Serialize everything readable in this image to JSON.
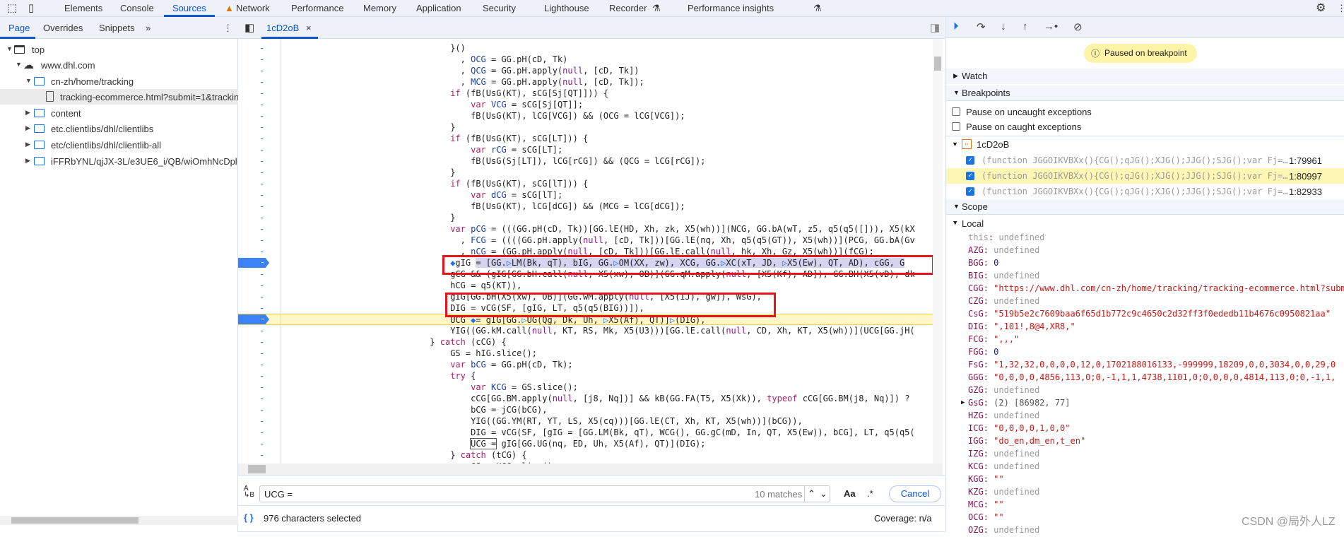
{
  "top_tabs": {
    "icons": [
      "inspect-element-icon",
      "device-toolbar-icon"
    ],
    "items": [
      "Elements",
      "Console",
      "Sources",
      "Network",
      "Performance",
      "Memory",
      "Application",
      "Security",
      "Lighthouse",
      "Recorder",
      "Performance insights"
    ],
    "active": "Sources",
    "network_warning": "warning-icon",
    "experimental": "flask-icon"
  },
  "left": {
    "tabs": [
      "Page",
      "Overrides",
      "Snippets"
    ],
    "more": "»",
    "active": "Page",
    "tree": [
      {
        "label": "top",
        "icon": "frame",
        "expanded": true
      },
      {
        "label": "www.dhl.com",
        "icon": "cloud",
        "expanded": true
      },
      {
        "label": "cn-zh/home/tracking",
        "icon": "folder",
        "expanded": true
      },
      {
        "label": "tracking-ecommerce.html?submit=1&tracking",
        "icon": "file",
        "selected": true
      },
      {
        "label": "content",
        "icon": "folder"
      },
      {
        "label": "etc.clientlibs/dhl/clientlibs",
        "icon": "folder"
      },
      {
        "label": "etc/clientlibs/dhl/clientlib-all",
        "icon": "folder"
      },
      {
        "label": "iFFRbYNL/qjJX-3L/e3UE6_i/QB/wiOmhNcDpl",
        "icon": "folder"
      }
    ]
  },
  "editor": {
    "tab": "1cD2oB",
    "close": "×"
  },
  "code": {
    "gutter": "-",
    "lines": [
      [
        [
          "                                }()",
          "p"
        ]
      ],
      [
        [
          "                                  , ",
          "p"
        ],
        [
          "OCG",
          "d"
        ],
        [
          " = GG.pH(cD, Tk)",
          "p"
        ]
      ],
      [
        [
          "                                  , ",
          "p"
        ],
        [
          "QCG",
          "d"
        ],
        [
          " = GG.pH.apply(",
          "p"
        ],
        [
          "null",
          "n"
        ],
        [
          ", [cD, Tk])",
          "p"
        ]
      ],
      [
        [
          "                                  , ",
          "p"
        ],
        [
          "MCG",
          "d"
        ],
        [
          " = GG.pH.apply(",
          "p"
        ],
        [
          "null",
          "n"
        ],
        [
          ", [cD, Tk]);",
          "p"
        ]
      ],
      [
        [
          "                                ",
          "p"
        ],
        [
          "if",
          "k"
        ],
        [
          " (fB(UsG(KT), sCG[Sj[QT]])) {",
          "p"
        ]
      ],
      [
        [
          "                                    ",
          "p"
        ],
        [
          "var",
          "k"
        ],
        [
          " ",
          "p"
        ],
        [
          "VCG",
          "d"
        ],
        [
          " = sCG[Sj[QT]];",
          "p"
        ]
      ],
      [
        [
          "                                    fB(UsG(KT), lCG[VCG]) && (OCG = lCG[VCG]);",
          "p"
        ]
      ],
      [
        [
          "                                }",
          "p"
        ]
      ],
      [
        [
          "                                ",
          "p"
        ],
        [
          "if",
          "k"
        ],
        [
          " (fB(UsG(KT), sCG[LT])) {",
          "p"
        ]
      ],
      [
        [
          "                                    ",
          "p"
        ],
        [
          "var",
          "k"
        ],
        [
          " ",
          "p"
        ],
        [
          "rCG",
          "d"
        ],
        [
          " = sCG[LT];",
          "p"
        ]
      ],
      [
        [
          "                                    fB(UsG(Sj[LT]), lCG[rCG]) && (QCG = lCG[rCG]);",
          "p"
        ]
      ],
      [
        [
          "                                }",
          "p"
        ]
      ],
      [
        [
          "                                ",
          "p"
        ],
        [
          "if",
          "k"
        ],
        [
          " (fB(UsG(KT), sCG[lT])) {",
          "p"
        ]
      ],
      [
        [
          "                                    ",
          "p"
        ],
        [
          "var",
          "k"
        ],
        [
          " ",
          "p"
        ],
        [
          "dCG",
          "d"
        ],
        [
          " = sCG[lT];",
          "p"
        ]
      ],
      [
        [
          "                                    fB(UsG(KT), lCG[dCG]) && (MCG = lCG[dCG]);",
          "p"
        ]
      ],
      [
        [
          "                                }",
          "p"
        ]
      ],
      [
        [
          "                                ",
          "p"
        ],
        [
          "var",
          "k"
        ],
        [
          " ",
          "p"
        ],
        [
          "pCG",
          "d"
        ],
        [
          " = (((GG.pH(cD, Tk))[GG.lE(HD, Xh, zk, X5(wh))](NCG, GG.bA(wT, z5, q5(q5([])), X5(kX",
          "p"
        ]
      ],
      [
        [
          "                                  , ",
          "p"
        ],
        [
          "FCG",
          "d"
        ],
        [
          " = ((((GG.pH.apply(",
          "p"
        ],
        [
          "null",
          "n"
        ],
        [
          ", [cD, Tk]))[GG.lE(nq, Xh, q5(q5(GT)), X5(wh))](PCG, GG.bA(Gv",
          "p"
        ]
      ],
      [
        [
          "                                  , ",
          "p"
        ],
        [
          "nCG",
          "d"
        ],
        [
          " = (GG.pH.apply(",
          "p"
        ],
        [
          "null",
          "n"
        ],
        [
          ", [cD, Tk]))[GG.lE.call(",
          "p"
        ],
        [
          "null",
          "n"
        ],
        [
          ", hk, Xh, Gz, X5(wh))](fCG);",
          "p"
        ]
      ],
      [
        [
          "                                ",
          "p"
        ],
        [
          "◆",
          "m"
        ],
        [
          "gIG ",
          "p"
        ],
        [
          "= [GG.",
          "sel"
        ],
        [
          "▷",
          "m sel"
        ],
        [
          "LM(Bk, qT), bIG, GG.",
          "sel"
        ],
        [
          "▷",
          "m sel"
        ],
        [
          "OM(XX, zw), XCG, GG.",
          "sel"
        ],
        [
          "▷",
          "m sel"
        ],
        [
          "XC(xT, JD, ",
          "sel"
        ],
        [
          "▷",
          "m sel"
        ],
        [
          "X5(Ew), QT, AD), cGG, G",
          "sel"
        ]
      ],
      [
        [
          "                                gCG && (gIG[GG.bH.call(",
          "p"
        ],
        [
          "null",
          "n"
        ],
        [
          ", X5(xw), OB)](GG.qM.apply(",
          "p"
        ],
        [
          "null",
          "n"
        ],
        [
          ", [X5(Kf), AD]), GG.BH(X5(vD), dk",
          "p"
        ]
      ],
      [
        [
          "                                hCG = q5(KT)),",
          "p"
        ]
      ],
      [
        [
          "                                gIG[GG.bH(X5(xw), OB)](GG.wM.apply(",
          "p"
        ],
        [
          "null",
          "n"
        ],
        [
          ", [X5(IJ), gw]), WsG),",
          "p"
        ]
      ],
      [
        [
          "                                DIG = vCG(SF, [gIG, LT, q5(q5(BIG))]),",
          "p"
        ]
      ],
      [
        [
          "                                UCG ",
          "p"
        ],
        [
          "◆",
          "m"
        ],
        [
          "= gIG[GG.",
          "p"
        ],
        [
          "▷",
          "m"
        ],
        [
          "UG(Qg, Dk, Uh, ",
          "p"
        ],
        [
          "▷",
          "m"
        ],
        [
          "X5(Af), QT)]",
          "p"
        ],
        [
          "▷",
          "m"
        ],
        [
          "(DIG),",
          "p"
        ]
      ],
      [
        [
          "                                YIG((GG.kM.call(",
          "p"
        ],
        [
          "null",
          "n"
        ],
        [
          ", KT, RS, Mk, X5(U3)))[GG.lE.call(",
          "p"
        ],
        [
          "null",
          "n"
        ],
        [
          ", CD, Xh, KT, X5(wh))](UCG[GG.jH(",
          "p"
        ]
      ],
      [
        [
          "                            } ",
          "p"
        ],
        [
          "catch",
          "k"
        ],
        [
          " (cCG) {",
          "p"
        ]
      ],
      [
        [
          "                                GS = hIG.slice();",
          "p"
        ]
      ],
      [
        [
          "                                ",
          "p"
        ],
        [
          "var",
          "k"
        ],
        [
          " ",
          "p"
        ],
        [
          "bCG",
          "d"
        ],
        [
          " = GG.pH(cD, Tk);",
          "p"
        ]
      ],
      [
        [
          "                                ",
          "p"
        ],
        [
          "try",
          "k"
        ],
        [
          " {",
          "p"
        ]
      ],
      [
        [
          "                                    ",
          "p"
        ],
        [
          "var",
          "k"
        ],
        [
          " ",
          "p"
        ],
        [
          "KCG",
          "d"
        ],
        [
          " = GS.slice();",
          "p"
        ]
      ],
      [
        [
          "                                    cCG[GG.BM.apply(",
          "p"
        ],
        [
          "null",
          "n"
        ],
        [
          ", [j8, Nq])] && kB(GG.FA(T5, X5(Xk)), ",
          "p"
        ],
        [
          "typeof",
          "k"
        ],
        [
          " cCG[GG.BM(j8, Nq)]) ?",
          "p"
        ]
      ],
      [
        [
          "                                    bCG = jCG(bCG),",
          "p"
        ]
      ],
      [
        [
          "                                    YIG((GG.YM(RT, YT, LS, X5(cq)))[GG.lE(CT, Xh, KT, X5(wh))](bCG)),",
          "p"
        ]
      ],
      [
        [
          "                                    DIG = vCG(SF, [gIG = [GG.LM(Bk, qT), WCG(), GG.gC(mD, In, QT, X5(Ew)), bCG], LT, q5(q5(",
          "p"
        ]
      ],
      [
        [
          "                                    ",
          "p"
        ],
        [
          "UCG =",
          "p box"
        ],
        [
          " gIG[GG.UG(nq, ED, Uh, X5(Af), QT)](DIG);",
          "p"
        ]
      ],
      [
        [
          "                                } ",
          "p"
        ],
        [
          "catch",
          "k"
        ],
        [
          " (tCG) {",
          "p"
        ]
      ],
      [
        [
          "                                    GS = KCG.slice();",
          "p"
        ]
      ]
    ],
    "breakpoint_lines": [
      19,
      24
    ],
    "paused_line": 24
  },
  "search": {
    "value": "UCG =",
    "matches": "10 matches",
    "case": "Aa",
    "regex": ".*",
    "cancel": "Cancel"
  },
  "status": {
    "selected": "976 characters selected",
    "coverage": "Coverage: n/a"
  },
  "debugger": {
    "paused": "Paused on breakpoint",
    "watch": "Watch",
    "breakpoints": "Breakpoints",
    "uncaught": "Pause on uncaught exceptions",
    "caught": "Pause on caught exceptions",
    "file": "1cD2oB",
    "bps": [
      {
        "code": "(function JGGOIKVBXx(){CG();qJG();XJG();JJG();SJG();var Fj=…",
        "loc": "1:79961"
      },
      {
        "code": "(function JGGOIKVBXx(){CG();qJG();XJG();JJG();SJG();var Fj=…",
        "loc": "1:80997",
        "current": true
      },
      {
        "code": "(function JGGOIKVBXx(){CG();qJG();XJG();JJG();SJG();var Fj=…",
        "loc": "1:82933"
      }
    ],
    "scope": "Scope",
    "local": "Local",
    "vars": [
      [
        "this",
        "undefined",
        "undef"
      ],
      [
        "AZG",
        "undefined",
        "undef"
      ],
      [
        "BGG",
        "0",
        "num"
      ],
      [
        "BIG",
        "undefined",
        "undef"
      ],
      [
        "CGG",
        "\"https://www.dhl.com/cn-zh/home/tracking/tracking-ecommerce.html?submit=1&tracking",
        "str"
      ],
      [
        "CZG",
        "undefined",
        "undef"
      ],
      [
        "CsG",
        "\"519b5e2c7609baa6f65d1b772c9c4650c2d32ff3f0ededb11b4676c0950821aa\"",
        "str"
      ],
      [
        "DIG",
        "\",101!,8@4,XR8,\"",
        "str"
      ],
      [
        "FCG",
        "\",,,\"",
        "str"
      ],
      [
        "FGG",
        "0",
        "num"
      ],
      [
        "FsG",
        "\"1,32,32,0,0,0,0,12,0,1702188016133,-999999,18209,0,0,3034,0,0,29,0",
        "str"
      ],
      [
        "GGG",
        "\"0,0,0,0,4856,113,0;0,-1,1,1,4738,1101,0;0,0,0,0,4814,113,0;0,-1,1,",
        "str"
      ],
      [
        "GZG",
        "undefined",
        "undef"
      ],
      [
        "GsG",
        "(2) [86982, 77]",
        "arr"
      ],
      [
        "HZG",
        "undefined",
        "undef"
      ],
      [
        "ICG",
        "\"0,0,0,0,1,0,0\"",
        "str"
      ],
      [
        "IGG",
        "\"do_en,dm_en,t_en\"",
        "str"
      ],
      [
        "IZG",
        "undefined",
        "undef"
      ],
      [
        "KCG",
        "undefined",
        "undef"
      ],
      [
        "KGG",
        "\"\"",
        "str"
      ],
      [
        "KZG",
        "undefined",
        "undef"
      ],
      [
        "MCG",
        "\"\"",
        "str"
      ],
      [
        "OCG",
        "\"\"",
        "str"
      ],
      [
        "OZG",
        "undefined",
        "undef"
      ]
    ]
  },
  "watermark": "CSDN @局外人LZ"
}
